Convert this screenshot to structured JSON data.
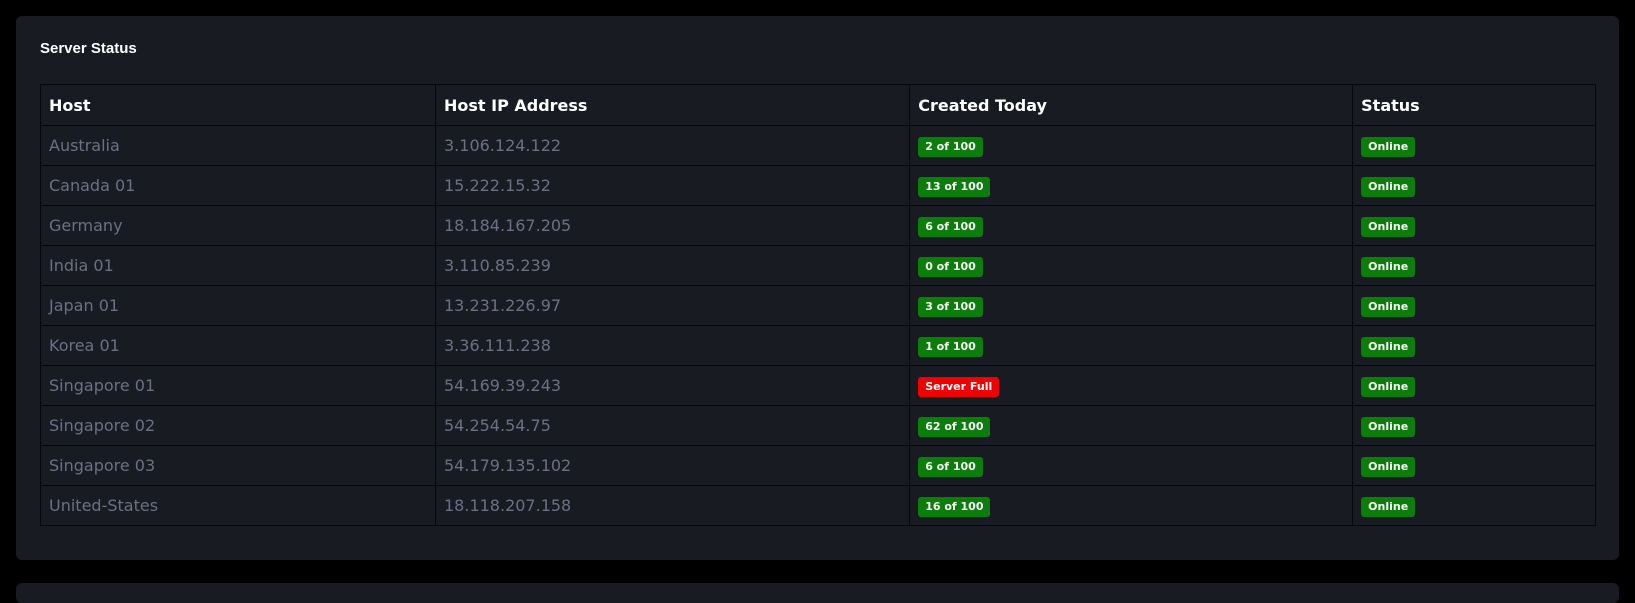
{
  "title": "Server Status",
  "columns": [
    "Host",
    "Host IP Address",
    "Created Today",
    "Status"
  ],
  "colors": {
    "ok": "#0a7d0a",
    "full": "#ee0000"
  },
  "rows": [
    {
      "host": "Australia",
      "ip": "3.106.124.122",
      "created": "2 of 100",
      "created_state": "ok",
      "status": "Online"
    },
    {
      "host": "Canada 01",
      "ip": "15.222.15.32",
      "created": "13 of 100",
      "created_state": "ok",
      "status": "Online"
    },
    {
      "host": "Germany",
      "ip": "18.184.167.205",
      "created": "6 of 100",
      "created_state": "ok",
      "status": "Online"
    },
    {
      "host": "India 01",
      "ip": "3.110.85.239",
      "created": "0 of 100",
      "created_state": "ok",
      "status": "Online"
    },
    {
      "host": "Japan 01",
      "ip": "13.231.226.97",
      "created": "3 of 100",
      "created_state": "ok",
      "status": "Online"
    },
    {
      "host": "Korea 01",
      "ip": "3.36.111.238",
      "created": "1 of 100",
      "created_state": "ok",
      "status": "Online"
    },
    {
      "host": "Singapore 01",
      "ip": "54.169.39.243",
      "created": "Server Full",
      "created_state": "full",
      "status": "Online"
    },
    {
      "host": "Singapore 02",
      "ip": "54.254.54.75",
      "created": "62 of 100",
      "created_state": "ok",
      "status": "Online"
    },
    {
      "host": "Singapore 03",
      "ip": "54.179.135.102",
      "created": "6 of 100",
      "created_state": "ok",
      "status": "Online"
    },
    {
      "host": "United-States",
      "ip": "18.118.207.158",
      "created": "16 of 100",
      "created_state": "ok",
      "status": "Online"
    }
  ]
}
